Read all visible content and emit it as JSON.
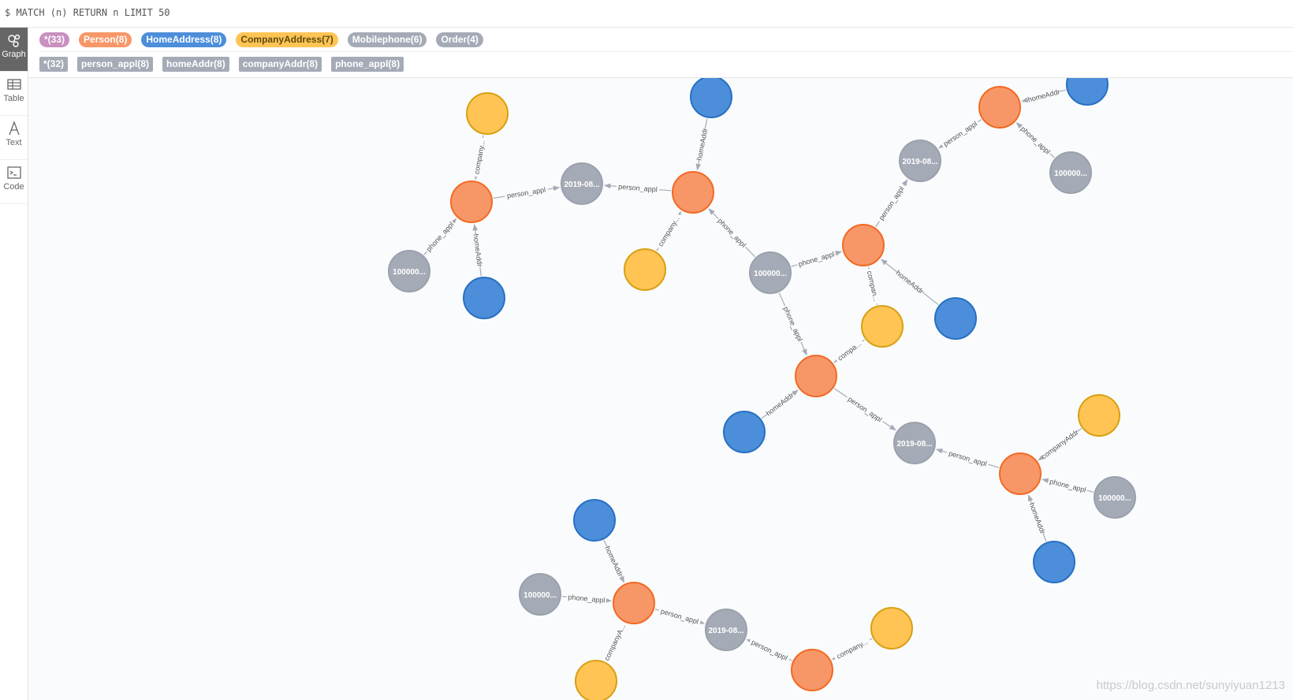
{
  "query": {
    "text": "$ MATCH (n) RETURN n LIMIT 50"
  },
  "sidebar": {
    "items": [
      {
        "label": "Graph",
        "icon": "graph-icon",
        "active": true
      },
      {
        "label": "Table",
        "icon": "table-icon",
        "active": false
      },
      {
        "label": "Text",
        "icon": "text-icon",
        "active": false
      },
      {
        "label": "Code",
        "icon": "code-icon",
        "active": false
      }
    ]
  },
  "legend": {
    "labels": [
      {
        "name": "*",
        "count": "(33)",
        "color": "#c990c0",
        "text_color": "#ffffff"
      },
      {
        "name": "Person",
        "count": "(8)",
        "color": "#f79767",
        "text_color": "#ffffff"
      },
      {
        "name": "HomeAddress",
        "count": "(8)",
        "color": "#4c8eda",
        "text_color": "#ffffff"
      },
      {
        "name": "CompanyAddress",
        "count": "(7)",
        "color": "#ffc454",
        "text_color": "#604a0e"
      },
      {
        "name": "Mobilephone",
        "count": "(6)",
        "color": "#a5abb6",
        "text_color": "#ffffff"
      },
      {
        "name": "Order",
        "count": "(4)",
        "color": "#a5abb6",
        "text_color": "#ffffff"
      }
    ],
    "relationships": [
      {
        "name": "*",
        "count": "(32)"
      },
      {
        "name": "person_appl",
        "count": "(8)"
      },
      {
        "name": "homeAddr",
        "count": "(8)"
      },
      {
        "name": "companyAddr",
        "count": "(8)"
      },
      {
        "name": "phone_appl",
        "count": "(8)"
      }
    ]
  },
  "graph": {
    "colors": {
      "person": "#f79767",
      "person_stroke": "#f36924",
      "home": "#4c8eda",
      "home_stroke": "#2870c2",
      "company": "#ffc454",
      "company_stroke": "#d7a013",
      "gray": "#a5abb6",
      "gray_stroke": "#9aa1ac",
      "edge": "#a5abb6",
      "edge_text": "#555555"
    },
    "node_labels": {
      "order": "2019-08...",
      "phone": "100000..."
    },
    "edge_labels": {
      "person_appl": "person_appl",
      "homeAddr": "homeAddr",
      "phone_appl": "phone_appl",
      "company": "company...",
      "compan": "compan...",
      "compa": "compa...",
      "companyAddr": "companyAddr",
      "companyA": "companyA..."
    }
  },
  "watermark": "https://blog.csdn.net/sunyiyuan1213"
}
